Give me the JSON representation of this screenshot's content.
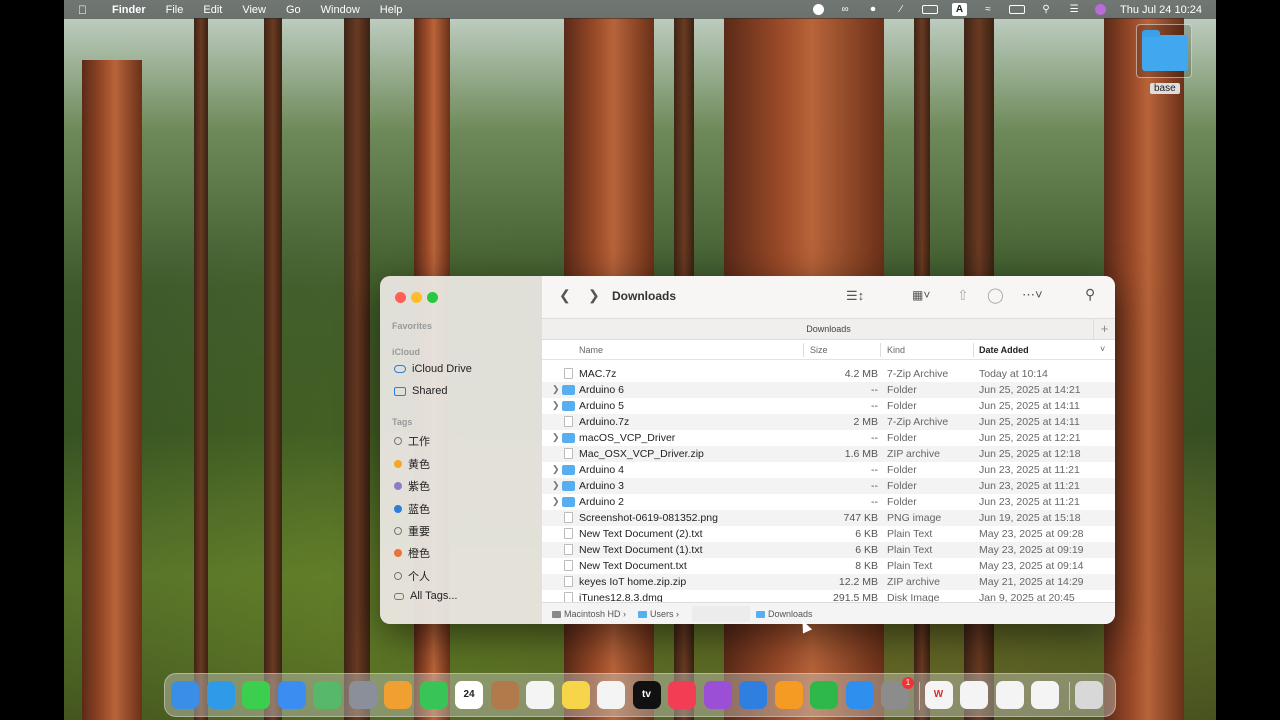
{
  "menubar": {
    "apple_icon": "apple-icon",
    "menus": [
      "Finder",
      "File",
      "Edit",
      "View",
      "Go",
      "Window",
      "Help"
    ],
    "input_source": "A",
    "clock": "Thu Jul 24  10:24"
  },
  "desktop": {
    "folder_label": "base"
  },
  "finder": {
    "window_title": "Downloads",
    "path_header": "Downloads",
    "sidebar": {
      "favorites_header": "Favorites",
      "icloud_header": "iCloud",
      "icloud_items": [
        "iCloud Drive",
        "Shared"
      ],
      "tags_header": "Tags",
      "tags": [
        {
          "label": "工作",
          "color": "",
          "hollow": true
        },
        {
          "label": "黄色",
          "color": "#f5a623"
        },
        {
          "label": "紫色",
          "color": "#8e7cc3"
        },
        {
          "label": "蓝色",
          "color": "#2b7fd6"
        },
        {
          "label": "重要",
          "color": "",
          "hollow": true
        },
        {
          "label": "橙色",
          "color": "#e8743b"
        },
        {
          "label": "个人",
          "color": "",
          "hollow": true
        },
        {
          "label": "All Tags...",
          "color": "",
          "hollow": true
        }
      ]
    },
    "columns": {
      "name": "Name",
      "size": "Size",
      "kind": "Kind",
      "date": "Date Added"
    },
    "files": [
      {
        "name": "MAC.7z",
        "size": "4.2 MB",
        "kind": "7-Zip Archive",
        "date": "Today at 10:14",
        "folder": false
      },
      {
        "name": "Arduino 6",
        "size": "--",
        "kind": "Folder",
        "date": "Jun 25, 2025 at 14:21",
        "folder": true
      },
      {
        "name": "Arduino 5",
        "size": "--",
        "kind": "Folder",
        "date": "Jun 25, 2025 at 14:11",
        "folder": true
      },
      {
        "name": "Arduino.7z",
        "size": "2 MB",
        "kind": "7-Zip Archive",
        "date": "Jun 25, 2025 at 14:11",
        "folder": false
      },
      {
        "name": "macOS_VCP_Driver",
        "size": "--",
        "kind": "Folder",
        "date": "Jun 25, 2025 at 12:21",
        "folder": true
      },
      {
        "name": "Mac_OSX_VCP_Driver.zip",
        "size": "1.6 MB",
        "kind": "ZIP archive",
        "date": "Jun 25, 2025 at 12:18",
        "folder": false
      },
      {
        "name": "Arduino 4",
        "size": "--",
        "kind": "Folder",
        "date": "Jun 23, 2025 at 11:21",
        "folder": true
      },
      {
        "name": "Arduino 3",
        "size": "--",
        "kind": "Folder",
        "date": "Jun 23, 2025 at 11:21",
        "folder": true
      },
      {
        "name": "Arduino 2",
        "size": "--",
        "kind": "Folder",
        "date": "Jun 23, 2025 at 11:21",
        "folder": true
      },
      {
        "name": "Screenshot-0619-081352.png",
        "size": "747 KB",
        "kind": "PNG image",
        "date": "Jun 19, 2025 at 15:18",
        "folder": false
      },
      {
        "name": "New Text Document (2).txt",
        "size": "6 KB",
        "kind": "Plain Text",
        "date": "May 23, 2025 at 09:28",
        "folder": false
      },
      {
        "name": "New Text Document (1).txt",
        "size": "6 KB",
        "kind": "Plain Text",
        "date": "May 23, 2025 at 09:19",
        "folder": false
      },
      {
        "name": "New Text Document.txt",
        "size": "8 KB",
        "kind": "Plain Text",
        "date": "May 23, 2025 at 09:14",
        "folder": false
      },
      {
        "name": "keyes IoT home.zip.zip",
        "size": "12.2 MB",
        "kind": "ZIP archive",
        "date": "May 21, 2025 at 14:29",
        "folder": false
      },
      {
        "name": "iTunes12.8.3.dmg",
        "size": "291.5 MB",
        "kind": "Disk Image",
        "date": "Jan 9, 2025 at 20:45",
        "folder": false
      }
    ],
    "pathbar": {
      "drive": "Macintosh HD",
      "users": "Users",
      "downloads": "Downloads"
    }
  },
  "dock": {
    "apps": [
      {
        "name": "finder-icon",
        "label": "",
        "color": "#3a8ee6"
      },
      {
        "name": "safari-icon",
        "label": "",
        "color": "#2f9be8"
      },
      {
        "name": "messages-icon",
        "label": "",
        "color": "#3ccf4e"
      },
      {
        "name": "mail-icon",
        "label": "",
        "color": "#3b8df2"
      },
      {
        "name": "maps-icon",
        "label": "",
        "color": "#58b86a"
      },
      {
        "name": "launchpad-icon",
        "label": "",
        "color": "#8a8f99"
      },
      {
        "name": "photos-icon",
        "label": "",
        "color": "#f0a030"
      },
      {
        "name": "facetime-icon",
        "label": "",
        "color": "#38c457"
      },
      {
        "name": "calendar-icon",
        "label": "24",
        "color": "#ffffff"
      },
      {
        "name": "contacts-icon",
        "label": "",
        "color": "#b07a4a"
      },
      {
        "name": "reminders-icon",
        "label": "",
        "color": "#f4f4f4"
      },
      {
        "name": "notes-icon",
        "label": "",
        "color": "#f7d54a"
      },
      {
        "name": "freeform-icon",
        "label": "",
        "color": "#f4f4f4"
      },
      {
        "name": "apple-tv-icon",
        "label": "tv",
        "color": "#111111"
      },
      {
        "name": "music-icon",
        "label": "",
        "color": "#f23d55"
      },
      {
        "name": "podcasts-icon",
        "label": "",
        "color": "#9b4fd6"
      },
      {
        "name": "keynote-icon",
        "label": "",
        "color": "#2f7fe0"
      },
      {
        "name": "pages-icon",
        "label": "",
        "color": "#f59a23"
      },
      {
        "name": "numbers-icon",
        "label": "",
        "color": "#2fb84a"
      },
      {
        "name": "app-store-icon",
        "label": "",
        "color": "#2f8fef"
      },
      {
        "name": "system-settings-icon",
        "label": "",
        "color": "#8c8c8c",
        "badge": "1"
      },
      {
        "name": "wps-icon",
        "label": "W",
        "color": "#f4f4f4"
      },
      {
        "name": "qq-icon",
        "label": "",
        "color": "#f4f4f4"
      },
      {
        "name": "vscode-icon",
        "label": "",
        "color": "#f4f4f4"
      },
      {
        "name": "feishu-icon",
        "label": "",
        "color": "#f4f4f4"
      },
      {
        "name": "trash-icon",
        "label": "",
        "color": "#d8d8d8"
      }
    ]
  }
}
